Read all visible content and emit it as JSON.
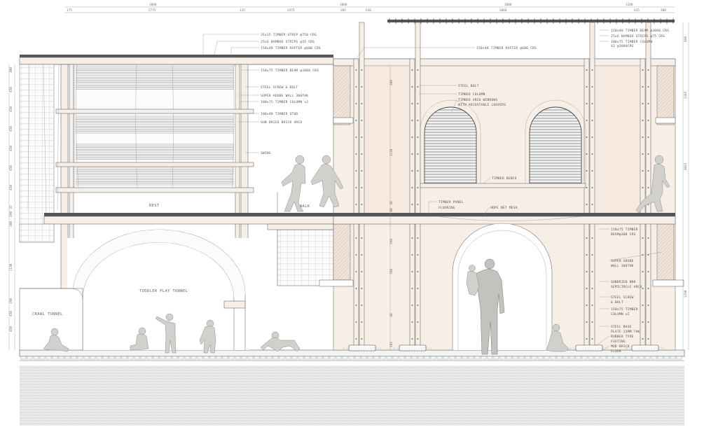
{
  "drawing": {
    "top_dimensions": {
      "row1": [
        "3880",
        "3880",
        "3880",
        "1260"
      ],
      "row2": [
        "175",
        "2775",
        "135",
        "2475",
        "385",
        "630",
        "3060",
        "635",
        "300"
      ]
    },
    "left_dimensions": [
      "300",
      "450",
      "450",
      "450",
      "450",
      "450",
      "450",
      "25",
      "290",
      "100",
      "1130",
      "190",
      "450",
      "450"
    ],
    "inner_left_dimensions": [
      "300",
      "1130",
      "20",
      "60",
      "290",
      "760",
      "60",
      "285"
    ],
    "right_dimensions": [
      "460",
      "1345",
      "2045",
      "1330"
    ],
    "annotations_left": [
      "35x15 TIMBER STRIP @750 CRS",
      "25x6 BAMBOO STRIPS @35 CRS",
      "150x40 TIMBER RAFTER @600 CRS",
      "150x75 TIMBER BEAM @3000 CRS",
      "STEEL SCREW & BOLT",
      "SUPER ADOBE WALL 300THK",
      "100x75 TIMBER COLUMN x2",
      "100x40 TIMBER STUD",
      "SUN DRIED BRICK ARCH",
      "SWING"
    ],
    "annotations_center": [
      "150x40 TIMBER RAFTER @600 CRS",
      "STEEL BOLT",
      "TIMBER COLUMN",
      "TIMBER ARCH WINDOWS",
      "WITH ADJUSTABLE LOUVERS",
      "TIMBER BENCH",
      "TIMBER PANEL",
      "FLOORING",
      "HDPE NET MESH"
    ],
    "annotations_right": [
      "150x40 TIMBER BEAM @3000 CRS",
      "25x6 BAMBOO STRIPS @75 CRS",
      "100x75 TIMBER COLUMN",
      "X2 @3000CRS",
      "150x75 TIMBER",
      "BEAM@300 CRS",
      "SUPER ADOBE",
      "WALL 300THK",
      "SUNDRIED BRK",
      "SEMICIRCLE ARCH",
      "STEEL SCREW",
      "& BOLT",
      "150x75 TIMBER",
      "COLUMN x2",
      "STEEL BASE",
      "PLATE 12MM THK",
      "RUBBER TYRE",
      "FOOTING",
      "MUD BRICK",
      "FLOOR"
    ],
    "space_labels": {
      "rest": "REST",
      "walk": "WALK",
      "toddler": "TODDLER PLAY TUNNEL",
      "crawl": "CRAWL TUNNEL"
    },
    "colors": {
      "wall_fill": "#f6ece4",
      "ground_hatch": "#e8e8e8",
      "line": "#666666"
    }
  }
}
